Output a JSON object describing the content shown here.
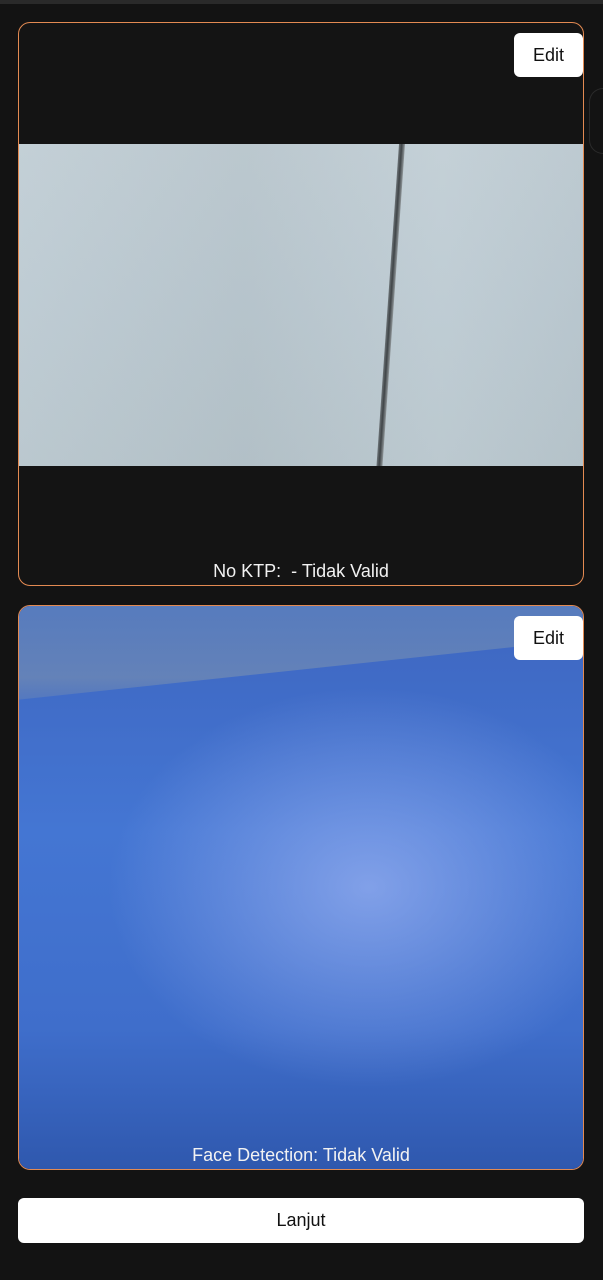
{
  "ktp_card": {
    "edit_label": "Edit",
    "status_text": "No KTP:  - Tidak Valid"
  },
  "face_card": {
    "edit_label": "Edit",
    "status_text": "Face Detection: Tidak Valid"
  },
  "footer": {
    "continue_label": "Lanjut"
  },
  "colors": {
    "background": "#131313",
    "card_border": "#e38a52",
    "button_background": "#ffffff",
    "caption_text": "#f2f2f2"
  }
}
